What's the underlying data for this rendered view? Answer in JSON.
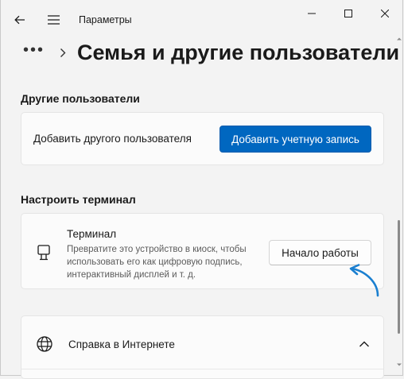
{
  "window": {
    "title": "Параметры"
  },
  "header": {
    "breadcrumb_more": "•••",
    "page_title": "Семья и другие пользователи"
  },
  "other_users": {
    "section_title": "Другие пользователи",
    "add_label": "Добавить другого пользователя",
    "add_button": "Добавить учетную запись"
  },
  "kiosk": {
    "section_title": "Настроить терминал",
    "title": "Терминал",
    "description": "Превратите это устройство в киоск, чтобы использовать его как цифровую подпись, интерактивный дисплей и т. д.",
    "button": "Начало работы",
    "icon": "kiosk-icon"
  },
  "help": {
    "title": "Справка в Интернете",
    "icon": "globe-icon",
    "expanded": true
  },
  "colors": {
    "accent": "#0067c0",
    "annotation_arrow": "#1a7fd0",
    "background": "#f3f3f3",
    "card": "#fbfbfb"
  }
}
